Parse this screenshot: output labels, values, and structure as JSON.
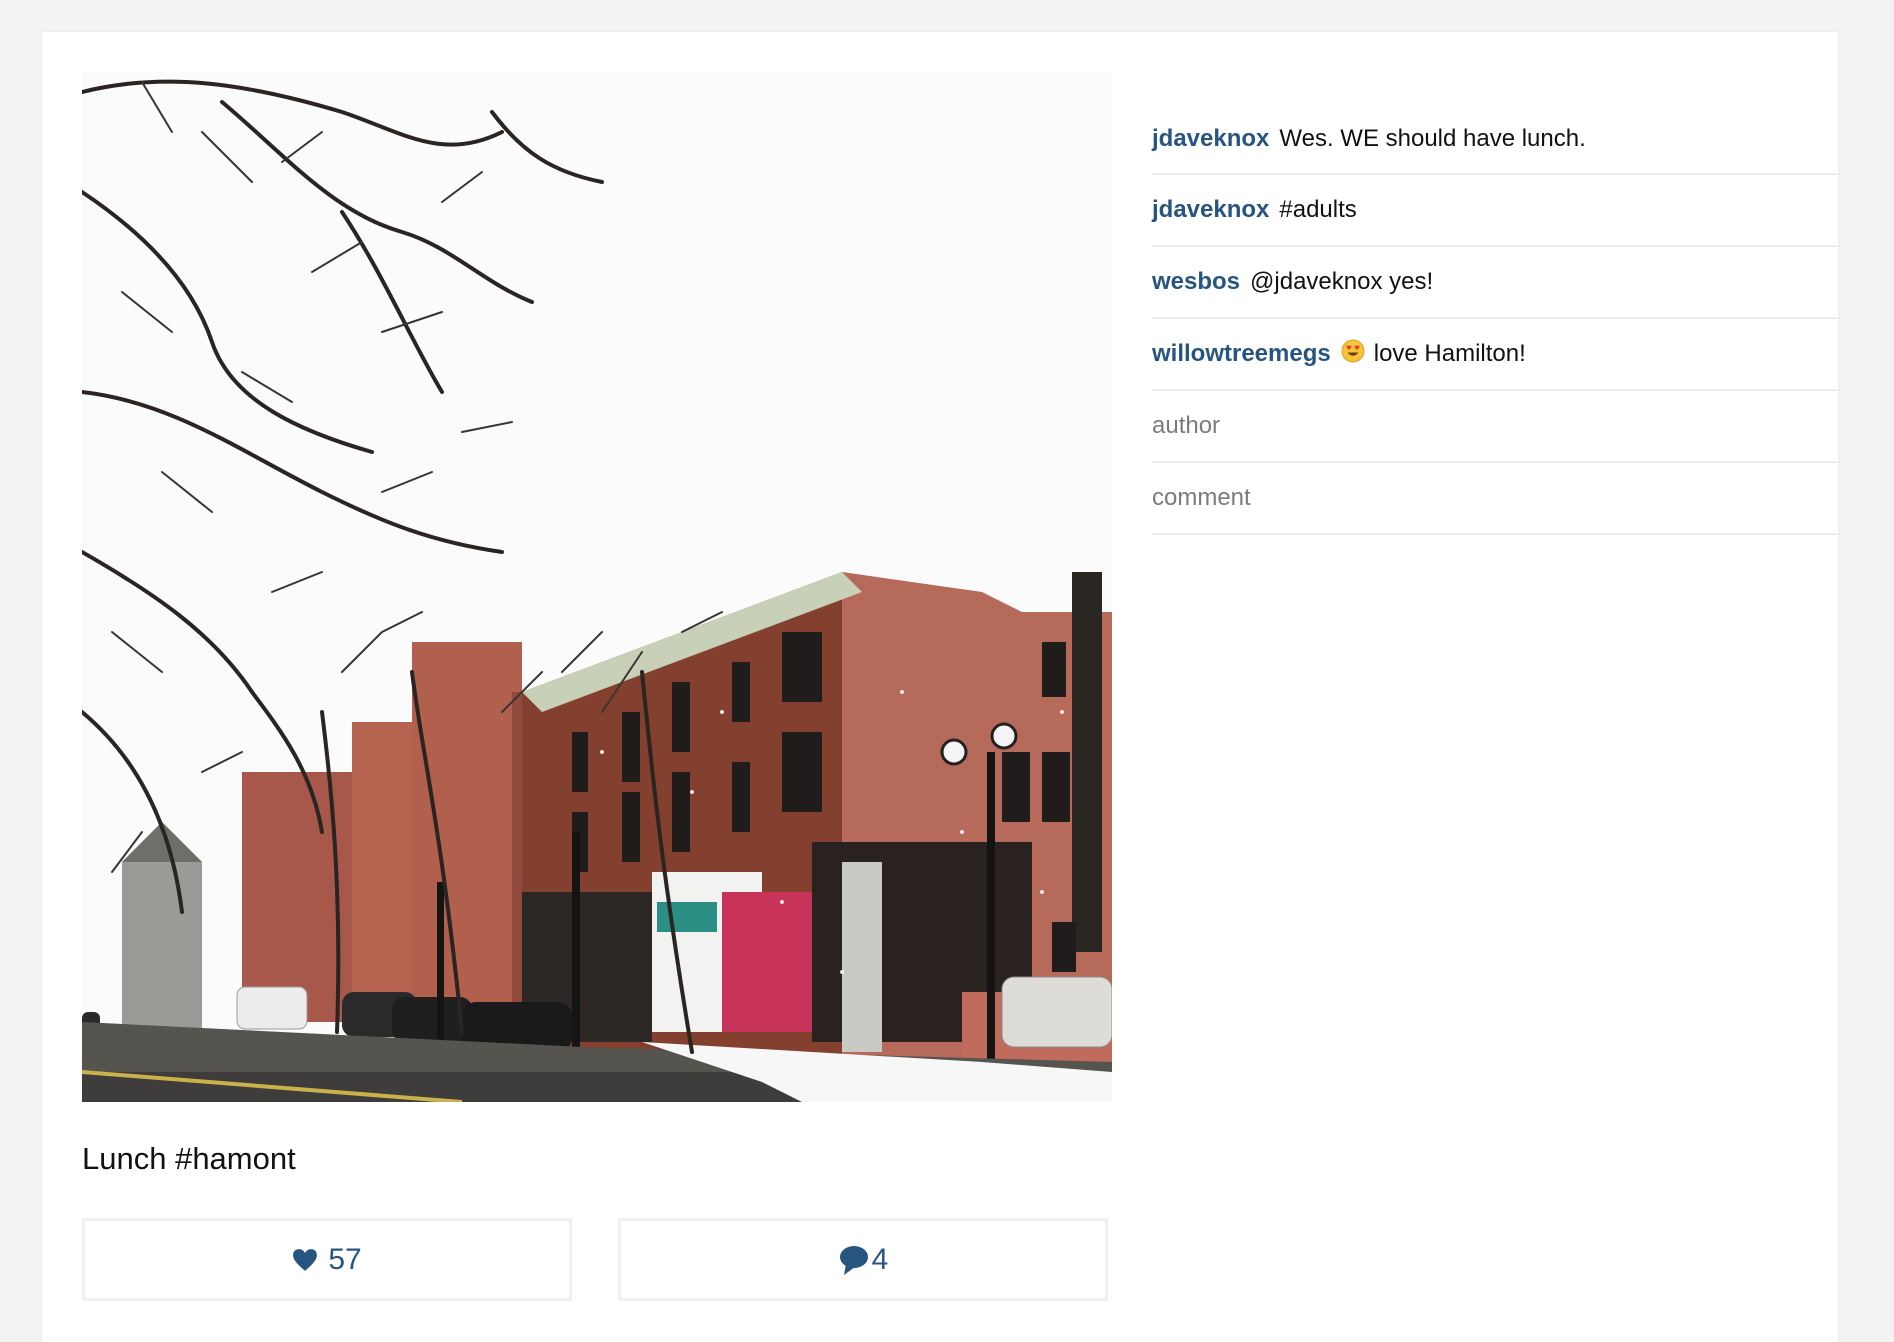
{
  "post": {
    "photo_alt": "Snowy street with brick buildings",
    "caption": "Lunch #hamont",
    "likes": "57",
    "comment_count": "4"
  },
  "comments": [
    {
      "user": "jdaveknox",
      "text": "Wes. WE should have lunch."
    },
    {
      "user": "jdaveknox",
      "text": "#adults"
    },
    {
      "user": "wesbos",
      "text": "@jdaveknox yes!"
    },
    {
      "user": "willowtreemegs",
      "emoji": "heart-eyes-face-icon",
      "text": "love Hamilton!"
    }
  ],
  "form": {
    "author_placeholder": "author",
    "comment_placeholder": "comment"
  },
  "colors": {
    "accent": "#275580",
    "border": "#ededed",
    "background": "#f3f3f3"
  }
}
